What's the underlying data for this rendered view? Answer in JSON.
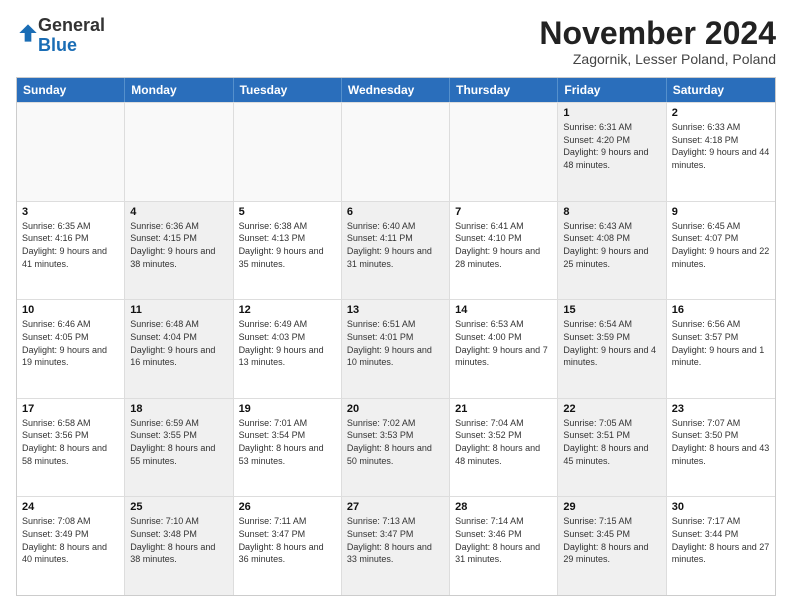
{
  "logo": {
    "general": "General",
    "blue": "Blue"
  },
  "header": {
    "month": "November 2024",
    "location": "Zagornik, Lesser Poland, Poland"
  },
  "weekdays": [
    "Sunday",
    "Monday",
    "Tuesday",
    "Wednesday",
    "Thursday",
    "Friday",
    "Saturday"
  ],
  "rows": [
    [
      {
        "day": "",
        "info": "",
        "shaded": false,
        "empty": true
      },
      {
        "day": "",
        "info": "",
        "shaded": false,
        "empty": true
      },
      {
        "day": "",
        "info": "",
        "shaded": false,
        "empty": true
      },
      {
        "day": "",
        "info": "",
        "shaded": false,
        "empty": true
      },
      {
        "day": "",
        "info": "",
        "shaded": false,
        "empty": true
      },
      {
        "day": "1",
        "info": "Sunrise: 6:31 AM\nSunset: 4:20 PM\nDaylight: 9 hours and 48 minutes.",
        "shaded": true,
        "empty": false
      },
      {
        "day": "2",
        "info": "Sunrise: 6:33 AM\nSunset: 4:18 PM\nDaylight: 9 hours and 44 minutes.",
        "shaded": false,
        "empty": false
      }
    ],
    [
      {
        "day": "3",
        "info": "Sunrise: 6:35 AM\nSunset: 4:16 PM\nDaylight: 9 hours and 41 minutes.",
        "shaded": false,
        "empty": false
      },
      {
        "day": "4",
        "info": "Sunrise: 6:36 AM\nSunset: 4:15 PM\nDaylight: 9 hours and 38 minutes.",
        "shaded": true,
        "empty": false
      },
      {
        "day": "5",
        "info": "Sunrise: 6:38 AM\nSunset: 4:13 PM\nDaylight: 9 hours and 35 minutes.",
        "shaded": false,
        "empty": false
      },
      {
        "day": "6",
        "info": "Sunrise: 6:40 AM\nSunset: 4:11 PM\nDaylight: 9 hours and 31 minutes.",
        "shaded": true,
        "empty": false
      },
      {
        "day": "7",
        "info": "Sunrise: 6:41 AM\nSunset: 4:10 PM\nDaylight: 9 hours and 28 minutes.",
        "shaded": false,
        "empty": false
      },
      {
        "day": "8",
        "info": "Sunrise: 6:43 AM\nSunset: 4:08 PM\nDaylight: 9 hours and 25 minutes.",
        "shaded": true,
        "empty": false
      },
      {
        "day": "9",
        "info": "Sunrise: 6:45 AM\nSunset: 4:07 PM\nDaylight: 9 hours and 22 minutes.",
        "shaded": false,
        "empty": false
      }
    ],
    [
      {
        "day": "10",
        "info": "Sunrise: 6:46 AM\nSunset: 4:05 PM\nDaylight: 9 hours and 19 minutes.",
        "shaded": false,
        "empty": false
      },
      {
        "day": "11",
        "info": "Sunrise: 6:48 AM\nSunset: 4:04 PM\nDaylight: 9 hours and 16 minutes.",
        "shaded": true,
        "empty": false
      },
      {
        "day": "12",
        "info": "Sunrise: 6:49 AM\nSunset: 4:03 PM\nDaylight: 9 hours and 13 minutes.",
        "shaded": false,
        "empty": false
      },
      {
        "day": "13",
        "info": "Sunrise: 6:51 AM\nSunset: 4:01 PM\nDaylight: 9 hours and 10 minutes.",
        "shaded": true,
        "empty": false
      },
      {
        "day": "14",
        "info": "Sunrise: 6:53 AM\nSunset: 4:00 PM\nDaylight: 9 hours and 7 minutes.",
        "shaded": false,
        "empty": false
      },
      {
        "day": "15",
        "info": "Sunrise: 6:54 AM\nSunset: 3:59 PM\nDaylight: 9 hours and 4 minutes.",
        "shaded": true,
        "empty": false
      },
      {
        "day": "16",
        "info": "Sunrise: 6:56 AM\nSunset: 3:57 PM\nDaylight: 9 hours and 1 minute.",
        "shaded": false,
        "empty": false
      }
    ],
    [
      {
        "day": "17",
        "info": "Sunrise: 6:58 AM\nSunset: 3:56 PM\nDaylight: 8 hours and 58 minutes.",
        "shaded": false,
        "empty": false
      },
      {
        "day": "18",
        "info": "Sunrise: 6:59 AM\nSunset: 3:55 PM\nDaylight: 8 hours and 55 minutes.",
        "shaded": true,
        "empty": false
      },
      {
        "day": "19",
        "info": "Sunrise: 7:01 AM\nSunset: 3:54 PM\nDaylight: 8 hours and 53 minutes.",
        "shaded": false,
        "empty": false
      },
      {
        "day": "20",
        "info": "Sunrise: 7:02 AM\nSunset: 3:53 PM\nDaylight: 8 hours and 50 minutes.",
        "shaded": true,
        "empty": false
      },
      {
        "day": "21",
        "info": "Sunrise: 7:04 AM\nSunset: 3:52 PM\nDaylight: 8 hours and 48 minutes.",
        "shaded": false,
        "empty": false
      },
      {
        "day": "22",
        "info": "Sunrise: 7:05 AM\nSunset: 3:51 PM\nDaylight: 8 hours and 45 minutes.",
        "shaded": true,
        "empty": false
      },
      {
        "day": "23",
        "info": "Sunrise: 7:07 AM\nSunset: 3:50 PM\nDaylight: 8 hours and 43 minutes.",
        "shaded": false,
        "empty": false
      }
    ],
    [
      {
        "day": "24",
        "info": "Sunrise: 7:08 AM\nSunset: 3:49 PM\nDaylight: 8 hours and 40 minutes.",
        "shaded": false,
        "empty": false
      },
      {
        "day": "25",
        "info": "Sunrise: 7:10 AM\nSunset: 3:48 PM\nDaylight: 8 hours and 38 minutes.",
        "shaded": true,
        "empty": false
      },
      {
        "day": "26",
        "info": "Sunrise: 7:11 AM\nSunset: 3:47 PM\nDaylight: 8 hours and 36 minutes.",
        "shaded": false,
        "empty": false
      },
      {
        "day": "27",
        "info": "Sunrise: 7:13 AM\nSunset: 3:47 PM\nDaylight: 8 hours and 33 minutes.",
        "shaded": true,
        "empty": false
      },
      {
        "day": "28",
        "info": "Sunrise: 7:14 AM\nSunset: 3:46 PM\nDaylight: 8 hours and 31 minutes.",
        "shaded": false,
        "empty": false
      },
      {
        "day": "29",
        "info": "Sunrise: 7:15 AM\nSunset: 3:45 PM\nDaylight: 8 hours and 29 minutes.",
        "shaded": true,
        "empty": false
      },
      {
        "day": "30",
        "info": "Sunrise: 7:17 AM\nSunset: 3:44 PM\nDaylight: 8 hours and 27 minutes.",
        "shaded": false,
        "empty": false
      }
    ]
  ]
}
